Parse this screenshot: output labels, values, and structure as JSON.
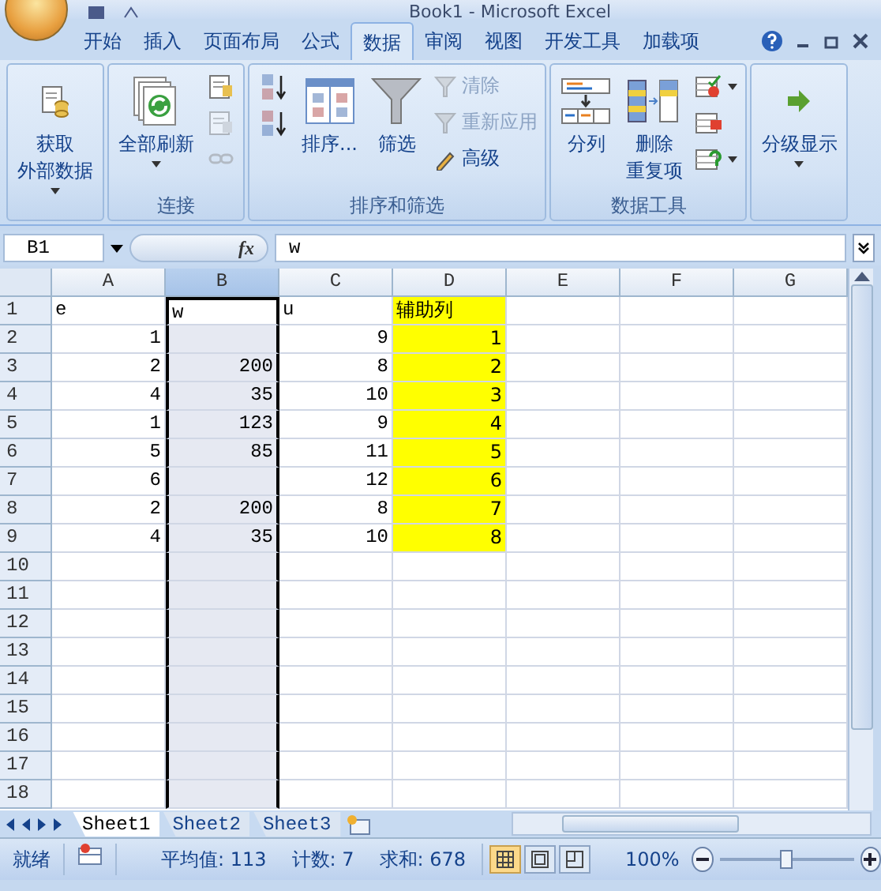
{
  "window": {
    "title": "Book1 - Microsoft Excel"
  },
  "ribbon": {
    "tabs": [
      {
        "label": "开始",
        "selected": false
      },
      {
        "label": "插入",
        "selected": false
      },
      {
        "label": "页面布局",
        "selected": false
      },
      {
        "label": "公式",
        "selected": false
      },
      {
        "label": "数据",
        "selected": true
      },
      {
        "label": "审阅",
        "selected": false
      },
      {
        "label": "视图",
        "selected": false
      },
      {
        "label": "开发工具",
        "selected": false
      },
      {
        "label": "加载项",
        "selected": false
      }
    ],
    "groups": [
      {
        "items": [
          {
            "kind": "large",
            "lines": [
              "获取",
              "外部数据"
            ],
            "dropdown": true,
            "disabled": false
          }
        ]
      },
      {
        "label": "连接",
        "items": [
          {
            "kind": "large",
            "lines": [
              "全部刷新"
            ],
            "dropdown": true,
            "disabled": false
          },
          {
            "kind": "icon",
            "dropdown": false,
            "disabled": false
          },
          {
            "kind": "icon",
            "dropdown": false,
            "disabled": true
          },
          {
            "kind": "icon",
            "dropdown": false,
            "disabled": true
          }
        ]
      },
      {
        "label": "排序和筛选",
        "items": [
          {
            "kind": "icon",
            "dropdown": false,
            "disabled": false
          },
          {
            "kind": "icon",
            "dropdown": false,
            "disabled": false
          },
          {
            "kind": "large",
            "lines": [
              "排序..."
            ],
            "dropdown": false,
            "disabled": false
          },
          {
            "kind": "large",
            "lines": [
              "筛选"
            ],
            "dropdown": false,
            "disabled": false
          },
          {
            "kind": "small",
            "label": "清除",
            "disabled": true
          },
          {
            "kind": "small",
            "label": "重新应用",
            "disabled": true
          },
          {
            "kind": "small",
            "label": "高级",
            "disabled": false
          }
        ]
      },
      {
        "label": "数据工具",
        "items": [
          {
            "kind": "large",
            "lines": [
              "分列"
            ],
            "dropdown": false,
            "disabled": false
          },
          {
            "kind": "large",
            "lines": [
              "删除",
              "重复项"
            ],
            "dropdown": false,
            "disabled": false
          },
          {
            "kind": "icon",
            "dropdown": true,
            "disabled": false
          },
          {
            "kind": "icon",
            "dropdown": false,
            "disabled": false
          },
          {
            "kind": "icon",
            "dropdown": true,
            "disabled": false
          }
        ]
      },
      {
        "items": [
          {
            "kind": "large",
            "lines": [
              "分级显示"
            ],
            "dropdown": true,
            "disabled": false
          }
        ]
      }
    ]
  },
  "formula_bar": {
    "name_box": "B1",
    "fx": "fx",
    "value": "w"
  },
  "grid": {
    "columns": [
      {
        "label": "A",
        "selected": false
      },
      {
        "label": "B",
        "selected": true
      },
      {
        "label": "C",
        "selected": false
      },
      {
        "label": "D",
        "selected": false
      },
      {
        "label": "E",
        "selected": false
      },
      {
        "label": "F",
        "selected": false
      },
      {
        "label": "G",
        "selected": false
      }
    ],
    "rows": [
      {
        "header": "1",
        "kind": "text",
        "cells": [
          {
            "text": "e",
            "highlighted": false
          },
          {
            "text": "w",
            "highlighted": false
          },
          {
            "text": "u",
            "highlighted": false
          },
          {
            "text": "辅助列",
            "highlighted": true
          },
          {
            "highlighted": false
          },
          {
            "highlighted": false
          },
          {
            "highlighted": false
          }
        ]
      },
      {
        "header": "2",
        "kind": "number",
        "cells": [
          {
            "text": "1",
            "highlighted": false
          },
          {
            "highlighted": false
          },
          {
            "text": "9",
            "highlighted": false
          },
          {
            "text": "1",
            "highlighted": true
          },
          {
            "highlighted": false
          },
          {
            "highlighted": false
          },
          {
            "highlighted": false
          }
        ]
      },
      {
        "header": "3",
        "kind": "number",
        "cells": [
          {
            "text": "2",
            "highlighted": false
          },
          {
            "text": "200",
            "highlighted": false
          },
          {
            "text": "8",
            "highlighted": false
          },
          {
            "text": "2",
            "highlighted": true
          },
          {
            "highlighted": false
          },
          {
            "highlighted": false
          },
          {
            "highlighted": false
          }
        ]
      },
      {
        "header": "4",
        "kind": "number",
        "cells": [
          {
            "text": "4",
            "highlighted": false
          },
          {
            "text": "35",
            "highlighted": false
          },
          {
            "text": "10",
            "highlighted": false
          },
          {
            "text": "3",
            "highlighted": true
          },
          {
            "highlighted": false
          },
          {
            "highlighted": false
          },
          {
            "highlighted": false
          }
        ]
      },
      {
        "header": "5",
        "kind": "number",
        "cells": [
          {
            "text": "1",
            "highlighted": false
          },
          {
            "text": "123",
            "highlighted": false
          },
          {
            "text": "9",
            "highlighted": false
          },
          {
            "text": "4",
            "highlighted": true
          },
          {
            "highlighted": false
          },
          {
            "highlighted": false
          },
          {
            "highlighted": false
          }
        ]
      },
      {
        "header": "6",
        "kind": "number",
        "cells": [
          {
            "text": "5",
            "highlighted": false
          },
          {
            "text": "85",
            "highlighted": false
          },
          {
            "text": "11",
            "highlighted": false
          },
          {
            "text": "5",
            "highlighted": true
          },
          {
            "highlighted": false
          },
          {
            "highlighted": false
          },
          {
            "highlighted": false
          }
        ]
      },
      {
        "header": "7",
        "kind": "number",
        "cells": [
          {
            "text": "6",
            "highlighted": false
          },
          {
            "highlighted": false
          },
          {
            "text": "12",
            "highlighted": false
          },
          {
            "text": "6",
            "highlighted": true
          },
          {
            "highlighted": false
          },
          {
            "highlighted": false
          },
          {
            "highlighted": false
          }
        ]
      },
      {
        "header": "8",
        "kind": "number",
        "cells": [
          {
            "text": "2",
            "highlighted": false
          },
          {
            "text": "200",
            "highlighted": false
          },
          {
            "text": "8",
            "highlighted": false
          },
          {
            "text": "7",
            "highlighted": true
          },
          {
            "highlighted": false
          },
          {
            "highlighted": false
          },
          {
            "highlighted": false
          }
        ]
      },
      {
        "header": "9",
        "kind": "number",
        "cells": [
          {
            "text": "4",
            "highlighted": false
          },
          {
            "text": "35",
            "highlighted": false
          },
          {
            "text": "10",
            "highlighted": false
          },
          {
            "text": "8",
            "highlighted": true
          },
          {
            "highlighted": false
          },
          {
            "highlighted": false
          },
          {
            "highlighted": false
          }
        ]
      },
      {
        "header": "10"
      },
      {
        "header": "11"
      },
      {
        "header": "12"
      },
      {
        "header": "13"
      },
      {
        "header": "14"
      },
      {
        "header": "15"
      },
      {
        "header": "16"
      },
      {
        "header": "17"
      },
      {
        "header": "18"
      }
    ]
  },
  "sheets": [
    {
      "label": "Sheet1",
      "selected": true
    },
    {
      "label": "Sheet2",
      "selected": false
    },
    {
      "label": "Sheet3",
      "selected": false
    }
  ],
  "status_bar": {
    "ready": "就绪",
    "stats": [
      "平均值: 113",
      "计数: 7",
      "求和: 678"
    ],
    "views": [
      {
        "selected": true
      },
      {
        "selected": false
      },
      {
        "selected": false
      }
    ],
    "zoom": {
      "reading": "100%",
      "level": 0.5
    }
  }
}
